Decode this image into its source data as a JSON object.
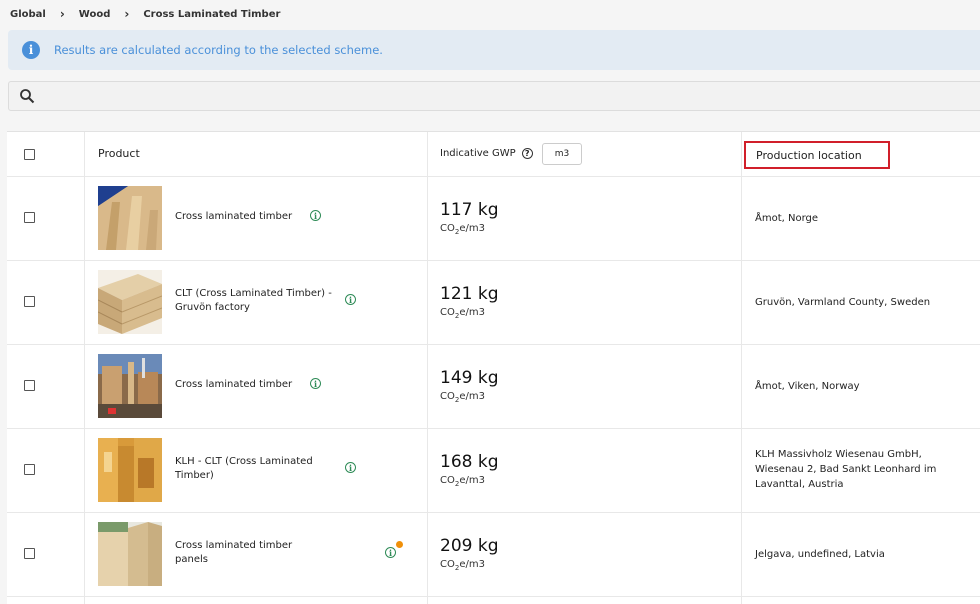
{
  "breadcrumb": {
    "items": [
      "Global",
      "Wood",
      "Cross Laminated Timber"
    ]
  },
  "banner": {
    "message": "Results are calculated according to the selected scheme."
  },
  "search": {
    "placeholder": "",
    "value": ""
  },
  "table": {
    "headers": {
      "product": "Product",
      "gwp": "Indicative GWP",
      "unit": "m3",
      "location": "Production location"
    },
    "rows": [
      {
        "product": "Cross laminated timber",
        "gwp": "117 kg",
        "unit": "CO2e/m3",
        "location": "Åmot, Norge"
      },
      {
        "product": "CLT (Cross Laminated Timber) - Gruvön factory",
        "gwp": "121 kg",
        "unit": "CO2e/m3",
        "location": "Gruvön, Varmland County, Sweden"
      },
      {
        "product": "Cross laminated timber",
        "gwp": "149 kg",
        "unit": "CO2e/m3",
        "location": "Åmot, Viken, Norway"
      },
      {
        "product": "KLH - CLT (Cross Laminated Timber)",
        "gwp": "168 kg",
        "unit": "CO2e/m3",
        "location": "KLH Massivholz Wiesenau GmbH, Wiesenau 2, Bad Sankt Leonhard im Lavanttal, Austria"
      },
      {
        "product": "Cross laminated timber panels",
        "gwp": "209 kg",
        "unit": "CO2e/m3",
        "location": "Jelgava, undefined, Latvia"
      }
    ]
  },
  "colors": {
    "accent": "#4a90d9",
    "highlight": "#d11f2a",
    "info_green": "#2e8b57",
    "dot_orange": "#f0900a"
  }
}
